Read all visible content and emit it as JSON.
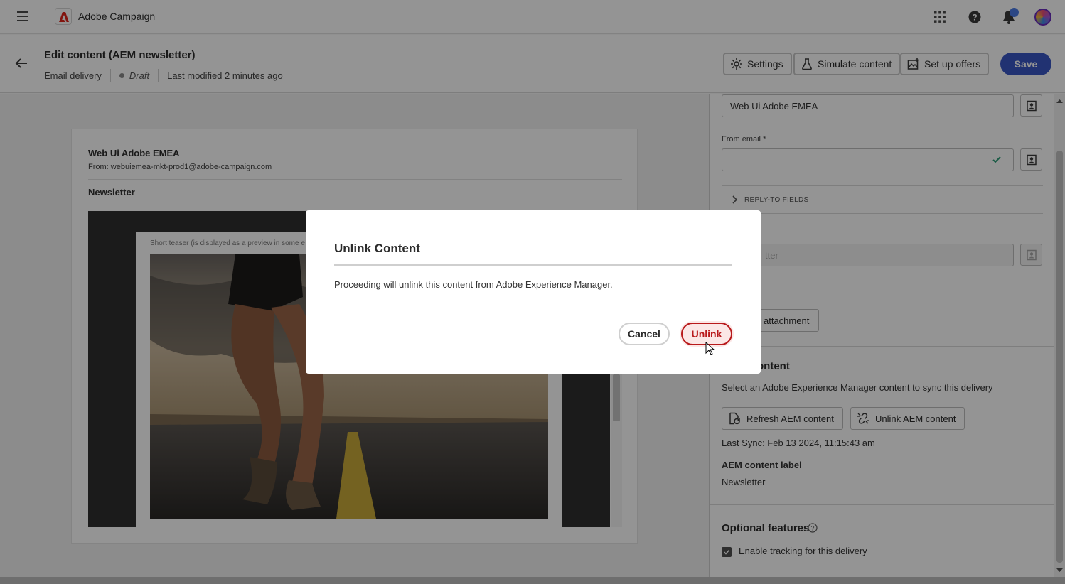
{
  "topbar": {
    "app_name": "Adobe Campaign",
    "icons": [
      "menu-icon",
      "adobe-logo-icon",
      "apps-grid-icon",
      "help-icon",
      "bell-icon",
      "avatar"
    ]
  },
  "header": {
    "title": "Edit content (AEM newsletter)",
    "channel": "Email delivery",
    "status": "Draft",
    "last_modified": "Last modified 2 minutes ago",
    "buttons": {
      "settings": "Settings",
      "simulate": "Simulate content",
      "offers": "Set up offers",
      "save": "Save"
    }
  },
  "email_preview": {
    "sender_name": "Web Ui Adobe EMEA",
    "from_line": "From: webuiemea-mkt-prod1@adobe-campaign.com",
    "subject": "Newsletter",
    "teaser": "Short teaser (is displayed as a preview in some e"
  },
  "panel": {
    "from_name_value": "Web Ui Adobe EMEA",
    "from_email_label": "From email",
    "from_email_value": "",
    "reply_to_label": "REPLY-TO FIELDS",
    "subject_label_fragment": "e",
    "subject_value_fragment": "tter",
    "attachment_btn": "attachment",
    "aem_section_title": "ontent",
    "aem_description": "Select an Adobe Experience Manager content to sync this delivery",
    "refresh_btn": "Refresh AEM content",
    "unlink_btn": "Unlink AEM content",
    "last_sync": "Last Sync: Feb 13 2024, 11:15:43 am",
    "aem_label_title": "AEM content label",
    "aem_label_value": "Newsletter",
    "optional_title": "Optional features",
    "tracking_label": "Enable tracking for this delivery",
    "tracking_checked": true
  },
  "dialog": {
    "title": "Unlink Content",
    "body": "Proceeding will unlink this content from Adobe Experience Manager.",
    "cancel": "Cancel",
    "confirm": "Unlink"
  },
  "colors": {
    "primary": "#3a56c4",
    "negative": "#b8191b",
    "brand_red": "#e1251b",
    "success": "#2d9d78"
  }
}
